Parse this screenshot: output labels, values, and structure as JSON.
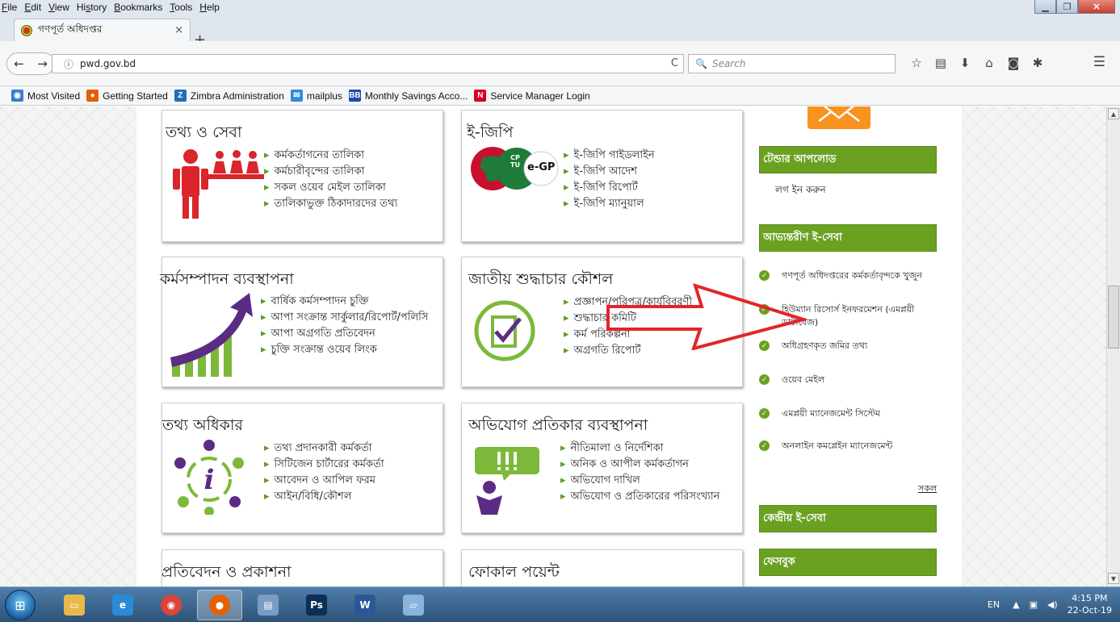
{
  "menubar": {
    "items": [
      {
        "key": "F",
        "rest": "ile"
      },
      {
        "key": "E",
        "rest": "dit"
      },
      {
        "key": "V",
        "rest": "iew"
      },
      {
        "pre": "Hi",
        "key": "s",
        "rest": "tory"
      },
      {
        "key": "B",
        "rest": "ookmarks"
      },
      {
        "key": "T",
        "rest": "ools"
      },
      {
        "key": "H",
        "rest": "elp"
      }
    ]
  },
  "tab": {
    "title": "গণপূর্ত অধিদপ্তর",
    "close": "×",
    "new": "+"
  },
  "nav": {
    "back": "←",
    "forward": "→",
    "url": "pwd.gov.bd",
    "info_icon": "ⓘ",
    "reload": "C",
    "search_placeholder": "Search",
    "search_icon": "🔍"
  },
  "toolbar_icons": [
    "☆",
    "▤",
    "⬇",
    "⌂",
    "◙",
    "✱"
  ],
  "bookmarks": [
    {
      "label": "Most Visited",
      "icon_color": "#3b7bd1",
      "glyph": "◉"
    },
    {
      "label": "Getting Started",
      "icon_color": "#e66000",
      "glyph": "●"
    },
    {
      "label": "Zimbra Administration",
      "icon_color": "#1f6fb5",
      "glyph": "Z"
    },
    {
      "label": "mailplus",
      "icon_color": "#2f8ad8",
      "glyph": "✉"
    },
    {
      "label": "Monthly Savings Acco...",
      "icon_color": "#1b4aa8",
      "glyph": "BB"
    },
    {
      "label": "Service Manager Login",
      "icon_color": "#d6001c",
      "glyph": "N"
    }
  ],
  "cards": [
    {
      "title": "তথ্য ও সেবা",
      "items": [
        "কর্মকর্তাগনের তালিকা",
        "কর্মচারীবৃন্দের তালিকা",
        "সকল ওয়েব মেইল তালিকা",
        "তালিকাভুক্ত ঠিকাদারদের তথ্য"
      ]
    },
    {
      "title": "ই-জিপি",
      "items": [
        "ই-জিপি গাইডলাইন",
        "ই-জিপি আদেশ",
        "ই-জিপি রিপোর্ট",
        "ই-জিপি ম্যানুয়াল"
      ]
    },
    {
      "title": "কর্মসম্পাদন ব্যবস্থাপনা",
      "items": [
        "বার্ষিক কর্মসম্পাদন চুক্তি",
        "আপা সংক্রান্ত সার্কুলার/রিপোর্ট/পলিসি",
        "আপা অগ্রগতি প্রতিবেদন",
        "চুক্তি সংক্রান্ত ওয়েব লিংক"
      ]
    },
    {
      "title": "জাতীয় শুদ্ধাচার কৌশল",
      "items": [
        "প্রজ্ঞাপন/পরিপত্র/কার্যবিবরণী",
        "শুদ্ধাচার কমিটি",
        "কর্ম পরিকল্পনা",
        "অগ্রগতি রিপোর্ট"
      ]
    },
    {
      "title": "তথ্য অধিকার",
      "items": [
        "তথ্য প্রদানকারী কর্মকর্তা",
        "সিটিজেন চার্টারের কর্মকর্তা",
        "আবেদন ও আপিল ফরম",
        "আইন/বিধি/কৌশল"
      ]
    },
    {
      "title": "অভিযোগ প্রতিকার ব্যবস্থাপনা",
      "items": [
        "নীতিমালা ও নির্দেশিকা",
        "অনিক ও আপীল কর্মকর্তাগন",
        "অভিযোগ দাখিল",
        "অভিযোগ ও প্রতিকারের পরিসংখ্যান"
      ]
    },
    {
      "title": "প্রতিবেদন ও প্রকাশনা",
      "items": []
    },
    {
      "title": "ফোকাল পয়েন্ট",
      "items": []
    }
  ],
  "egp_logo": {
    "cptu": "CPTU",
    "egp": "e-GP"
  },
  "sidebar": {
    "tender_head": "টেন্ডার আপলোড",
    "login": "লগ ইন করুন",
    "internal_head": "আভ্যন্তরীণ ই-সেবা",
    "eservices": [
      "গণপূর্ত অধিদপ্তরের কর্মকর্তাবৃন্দকে খুজুন",
      "হিউম্যান রিসোর্স ইনফরমেশন (এমপ্লয়ী ডাটাবেজ)",
      "অধিগ্রহণকৃত জমির তথ্য",
      "ওয়েব মেইল",
      "এমপ্লয়ী ম্যানেজমেন্ট সিস্টেম",
      "অনলাইন কমপ্লেইন ম্যানেজমেন্ট"
    ],
    "more": "সকল",
    "central_head": "কেন্দ্রীয় ই-সেবা",
    "facebook_head": "ফেসবুক"
  },
  "taskbar": {
    "apps": [
      {
        "name": "explorer",
        "color": "#e9b84a",
        "glyph": "▭"
      },
      {
        "name": "ie",
        "color": "#2a8ad4",
        "glyph": "e"
      },
      {
        "name": "chrome",
        "color": "#db4437",
        "glyph": "◉"
      },
      {
        "name": "firefox",
        "color": "#e66000",
        "glyph": "●"
      },
      {
        "name": "notepad",
        "color": "#7a9cc4",
        "glyph": "▤"
      },
      {
        "name": "photoshop",
        "color": "#0b2f55",
        "glyph": "Ps"
      },
      {
        "name": "word",
        "color": "#2b579a",
        "glyph": "W"
      },
      {
        "name": "window",
        "color": "#89b4dc",
        "glyph": "▱"
      }
    ],
    "lang": "EN",
    "time": "4:15 PM",
    "date": "22-Oct-19"
  },
  "colors": {
    "accent_green": "#6aa121",
    "arrow_red": "#e3242b",
    "orange": "#f7931e"
  }
}
